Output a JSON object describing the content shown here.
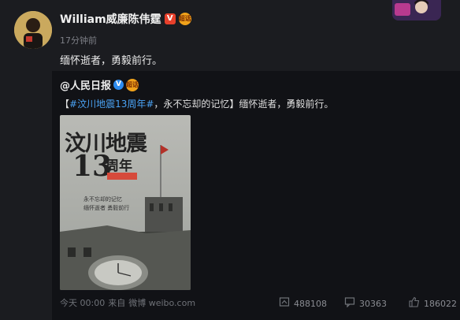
{
  "post": {
    "username": "William威廉陈伟霆",
    "verified_badge": "V",
    "medal_badge": "超话",
    "time": "17分钟前",
    "text": "缅怀逝者，勇毅前行。"
  },
  "repost": {
    "username": "@人民日报",
    "verified_badge": "V",
    "medal_badge": "超话",
    "text_open": "【",
    "hashtag": "#汶川地震13周年#",
    "text_rest": "，永不忘却的记忆】缅怀逝者，勇毅前行。",
    "poster": {
      "title": "汶川地震",
      "number": "13",
      "suffix": "周年",
      "line1": "永不忘却的记忆",
      "line2": "缅怀逝者  勇毅前行",
      "sky_color": "#aeb0ab"
    }
  },
  "footer": {
    "time": "今天 00:00",
    "source_prefix": "来自",
    "source": "微博 weibo.com",
    "repost_count": "488108",
    "comment_count": "30363",
    "like_count": "186022"
  },
  "colors": {
    "background": "#1b1c20",
    "repost_background": "#111216",
    "link": "#4aa3f5",
    "meta_text": "#7d7f86"
  }
}
